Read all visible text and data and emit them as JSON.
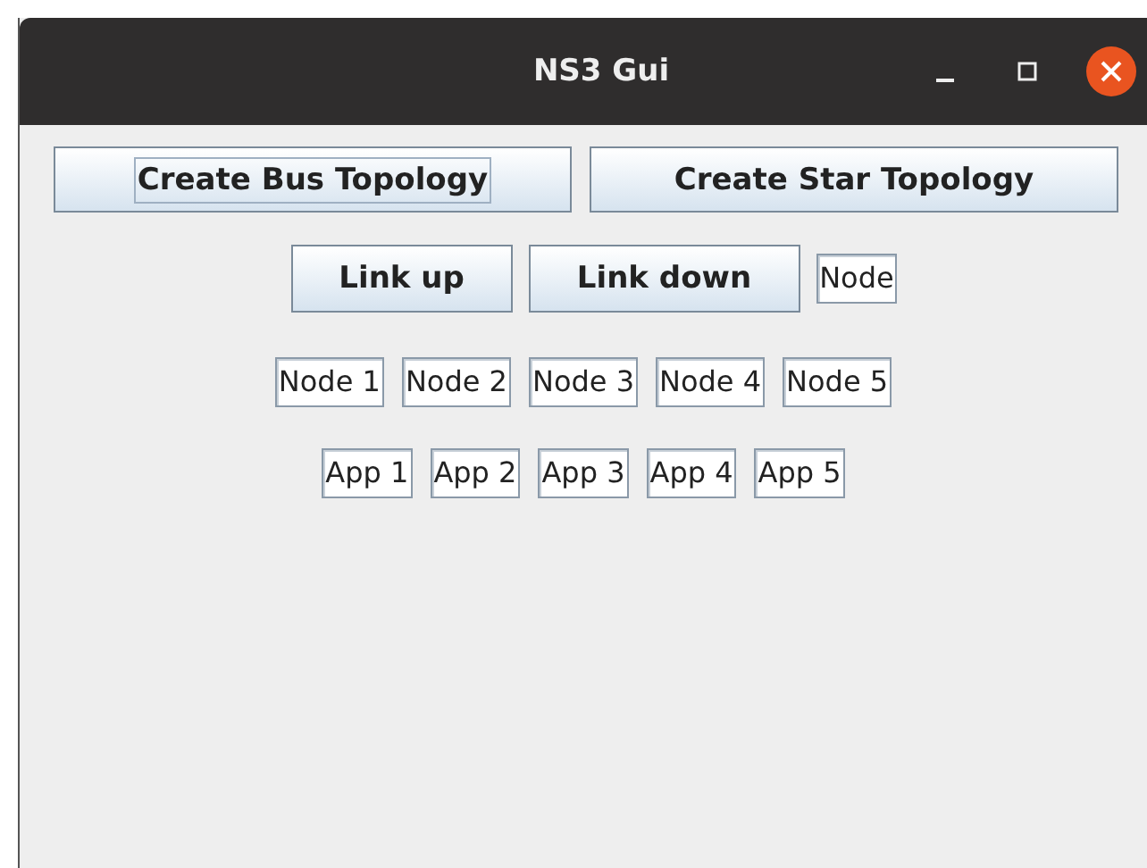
{
  "window": {
    "title": "NS3 Gui"
  },
  "topology_buttons": [
    {
      "label": "Create Bus Topology",
      "focused": true
    },
    {
      "label": "Create Star Topology",
      "focused": false
    }
  ],
  "link_buttons": [
    {
      "label": "Link up"
    },
    {
      "label": "Link down"
    }
  ],
  "node_field": {
    "value": "Node"
  },
  "node_fields": [
    {
      "value": "Node 1"
    },
    {
      "value": "Node 2"
    },
    {
      "value": "Node 3"
    },
    {
      "value": "Node 4"
    },
    {
      "value": "Node 5"
    }
  ],
  "app_fields": [
    {
      "value": "App 1"
    },
    {
      "value": "App 2"
    },
    {
      "value": "App 3"
    },
    {
      "value": "App 4"
    },
    {
      "value": "App 5"
    }
  ]
}
